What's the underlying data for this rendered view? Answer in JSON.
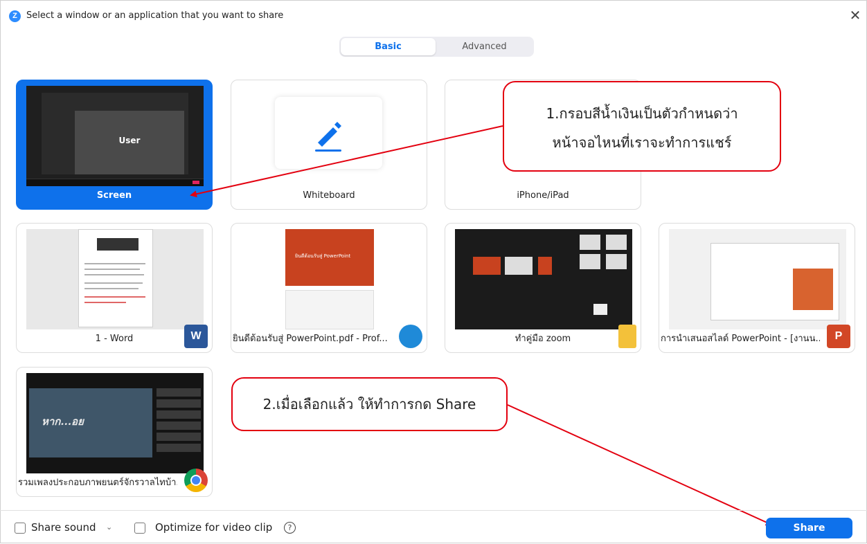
{
  "window": {
    "title": "Select a window or an application that you want to share",
    "logo": "Z",
    "close": "✕"
  },
  "tabs": [
    {
      "label": "Basic",
      "selected": true
    },
    {
      "label": "Advanced",
      "selected": false
    }
  ],
  "tiles": {
    "screen": {
      "label": "Screen",
      "preview_text": "User",
      "selected": true
    },
    "whiteboard": {
      "label": "Whiteboard",
      "icon": "pen-icon"
    },
    "iphone": {
      "label": "iPhone/iPad"
    },
    "word": {
      "label": "1 - Word",
      "icon": "word-icon",
      "icon_text": "W"
    },
    "pdf": {
      "label": "ยินดีต้อนรับสู่ PowerPoint.pdf - Prof...",
      "icon": "edge-icon",
      "preview_text": "ยินดีต้อนรับสู่ PowerPoint"
    },
    "zoom": {
      "label": "ทำคู่มือ zoom",
      "icon": "folder-icon"
    },
    "ppt": {
      "label": "การนำเสนอสไลด์ PowerPoint - [งานน...",
      "icon": "powerpoint-icon",
      "icon_text": "P"
    },
    "chrome": {
      "label": "รวมเพลงประกอบภาพยนตร์จักรวาลไทบ้า...",
      "icon": "chrome-icon",
      "preview_text": "หาก...อย"
    }
  },
  "annotations": {
    "callout1_line1": "1.กรอบสีน้ำเงินเป็นตัวกำหนดว่า",
    "callout1_line2": "หน้าจอไหนที่เราจะทำการแชร์",
    "callout2": "2.เมื่อเลือกแล้ว ให้ทำการกด Share"
  },
  "footer": {
    "share_sound": "Share sound",
    "share_sound_checked": false,
    "optimize": "Optimize for video clip",
    "optimize_checked": false,
    "help": "?",
    "share_button": "Share"
  },
  "colors": {
    "accent": "#0e71eb",
    "annotation": "#e3000f"
  }
}
